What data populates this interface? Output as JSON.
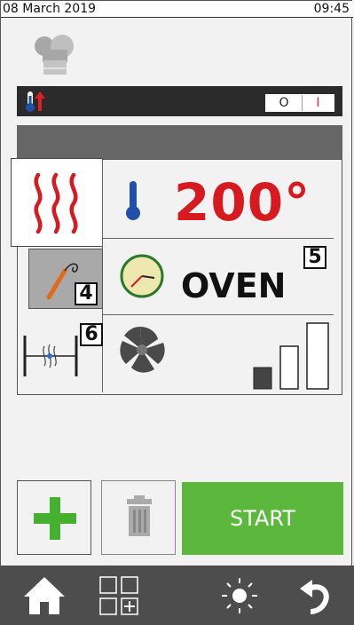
{
  "status_bar": {
    "date": "08 March 2019",
    "time": "09:45"
  },
  "mode_bar": {
    "toggle_off": "O",
    "toggle_on": "I"
  },
  "cooking": {
    "temperature": "200°",
    "mode_label": "OVEN",
    "badges": {
      "probe": "4",
      "mode": "5",
      "damper": "6"
    },
    "fan_speed_level": 1,
    "fan_speed_max": 3
  },
  "actions": {
    "start_label": "START"
  },
  "colors": {
    "accent_red": "#d71920",
    "start_green": "#5cb83c",
    "add_green": "#46b030",
    "nav_bar": "#4d4d4d"
  },
  "icons": [
    "chef-hat-icon",
    "thermometer-up-icon",
    "heat-waves-icon",
    "thermometer-icon",
    "probe-icon",
    "clock-icon",
    "damper-icon",
    "fan-icon",
    "fan-speed-bars-icon",
    "plus-icon",
    "trash-icon",
    "home-icon",
    "grid-add-icon",
    "light-icon",
    "back-icon"
  ]
}
